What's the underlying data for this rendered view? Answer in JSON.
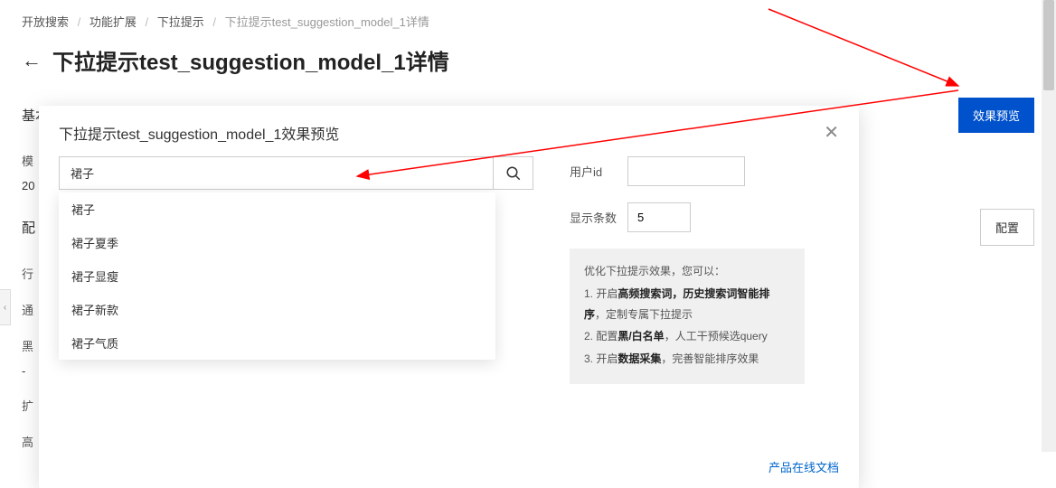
{
  "breadcrumb": {
    "items": [
      "开放搜索",
      "功能扩展",
      "下拉提示"
    ],
    "current": "下拉提示test_suggestion_model_1详情"
  },
  "header": {
    "title": "下拉提示test_suggestion_model_1详情"
  },
  "sections": {
    "basic_info_title": "基本信息",
    "preview_btn": "效果预览",
    "config_title_prefix": "配",
    "config_btn": "配置",
    "row1_prefix": "模",
    "row1_value": "20",
    "row2_prefix": "行",
    "row3_prefix": "通",
    "row4_prefix": "黑",
    "row4_value": "-",
    "row5_prefix": "扩",
    "row6_prefix": "高"
  },
  "modal": {
    "title": "下拉提示test_suggestion_model_1效果预览",
    "search_value": "裙子",
    "suggestions": [
      "裙子",
      "裙子夏季",
      "裙子显瘦",
      "裙子新款",
      "裙子气质"
    ],
    "user_id_label": "用户id",
    "user_id_value": "",
    "count_label": "显示条数",
    "count_value": "5",
    "tips": {
      "intro": "优化下拉提示效果，您可以：",
      "line1_prefix": "1. 开启",
      "line1_bold": "高频搜索词，历史搜索词智能排序",
      "line1_suffix": "，定制专属下拉提示",
      "line2_prefix": "2. 配置",
      "line2_bold": "黑/白名单",
      "line2_suffix": "，人工干预候选query",
      "line3_prefix": "3. 开启",
      "line3_bold": "数据采集",
      "line3_suffix": "，完善智能排序效果"
    },
    "doc_link": "产品在线文档"
  }
}
